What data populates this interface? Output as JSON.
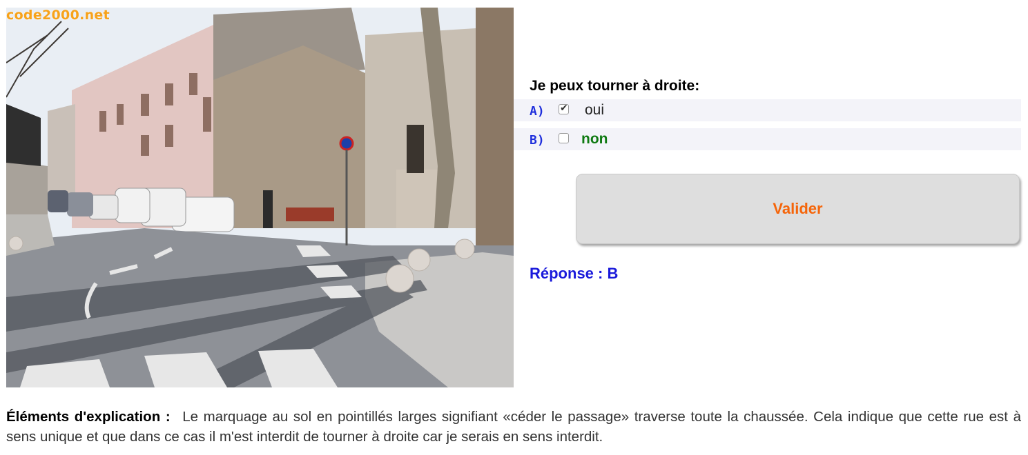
{
  "photo": {
    "watermark": "code2000.net",
    "description_icon": "street-scene-image"
  },
  "question": {
    "text": "Je peux tourner à droite:"
  },
  "answers": [
    {
      "letter": "A)",
      "label": "oui",
      "checked": true
    },
    {
      "letter": "B)",
      "label": "non",
      "checked": false
    }
  ],
  "validate": {
    "label": "Valider"
  },
  "result": {
    "text": "Réponse : B"
  },
  "explanation": {
    "title": "Éléments d'explication :",
    "body": "Le marquage au sol en pointillés larges signifiant «céder le passage» traverse toute la chaussée. Cela indique que cette rue est à sens unique et que dans ce cas il m'est interdit de tourner à droite car je serais en sens interdit."
  },
  "colors": {
    "letter": "#1f2fdc",
    "correct_answer": "#0f7a12",
    "validate_text": "#f5650a",
    "result_text": "#1a1adb",
    "watermark": "#f7a21a"
  }
}
